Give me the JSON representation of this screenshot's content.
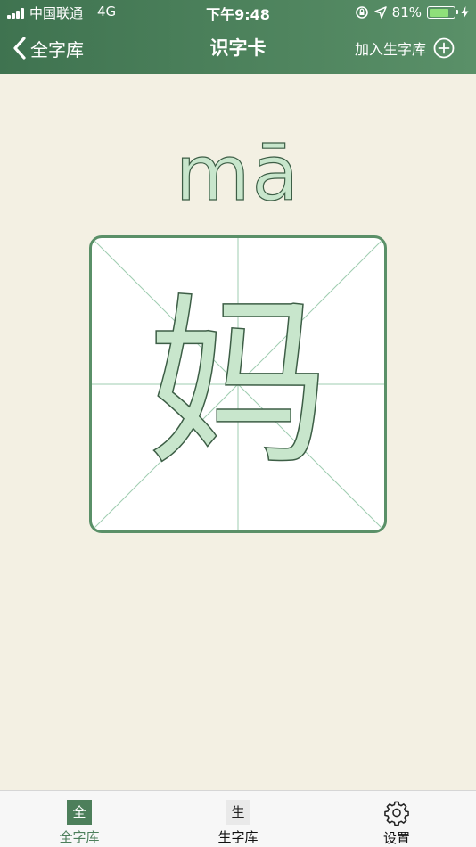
{
  "status_bar": {
    "carrier": "中国联通",
    "network": "4G",
    "time": "下午9:48",
    "battery": "81%",
    "battery_level": 0.81
  },
  "nav": {
    "back_label": "全字库",
    "title": "识字卡",
    "add_label": "加入生字库"
  },
  "card": {
    "pinyin": "mā",
    "character": "妈"
  },
  "tabbar": {
    "tabs": [
      {
        "icon_char": "全",
        "label": "全字库",
        "active": true
      },
      {
        "icon_char": "生",
        "label": "生字库",
        "active": false
      },
      {
        "icon": "gear-icon",
        "label": "设置",
        "active": false
      }
    ]
  },
  "colors": {
    "header": "#4a7d58",
    "accent": "#4d7f5b",
    "background": "#f3f0e3",
    "glyph_fill": "#c8e6cc"
  }
}
